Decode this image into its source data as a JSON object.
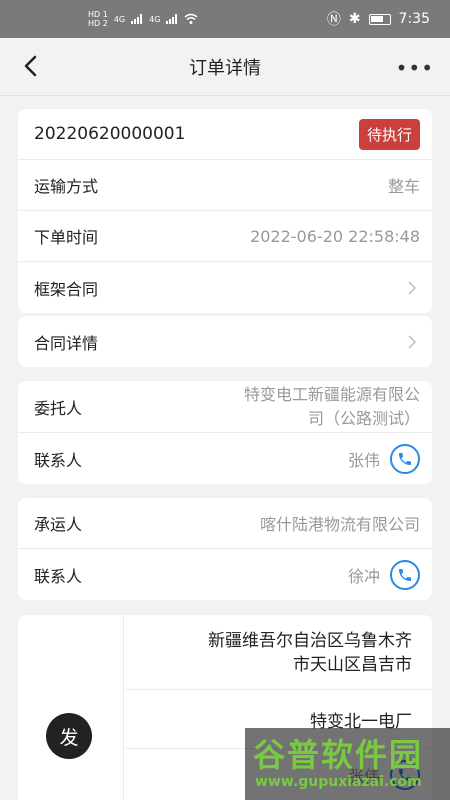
{
  "status_bar": {
    "sim1": "HD 1",
    "sim2": "HD 2",
    "net1": "4G",
    "net2": "4G",
    "time": "7:35"
  },
  "nav": {
    "title": "订单详情",
    "more": "•••"
  },
  "order": {
    "number": "20220620000001",
    "status": "待执行",
    "status_color": "#c9403d",
    "transport_label": "运输方式",
    "transport_value": "整车",
    "time_label": "下单时间",
    "time_value": "2022-06-20 22:58:48",
    "framework_label": "框架合同",
    "contract_label": "合同详情"
  },
  "consignor": {
    "label": "委托人",
    "value_line1": "特变电工新疆能源有限公",
    "value_line2": "司（公路测试）",
    "contact_label": "联系人",
    "contact_value": "张伟"
  },
  "carrier": {
    "label": "承运人",
    "value": "喀什陆港物流有限公司",
    "contact_label": "联系人",
    "contact_value": "徐冲"
  },
  "route": {
    "badge": "发",
    "address_line1": "新疆维吾尔自治区乌鲁木齐",
    "address_line2": "市天山区昌吉市",
    "site": "特变北一电厂",
    "contact": "张伟"
  },
  "watermark": {
    "title": "谷普软件园",
    "url": "www.gupuxiazai.com"
  },
  "colors": {
    "accent_blue": "#2a8ae6",
    "watermark_green": "#7ac943"
  }
}
